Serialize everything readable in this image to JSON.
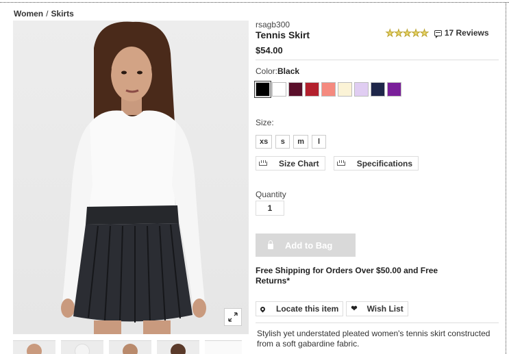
{
  "breadcrumb": {
    "parent": "Women",
    "separator": "/",
    "current": "Skirts"
  },
  "product": {
    "sku": "rsagb300",
    "title": "Tennis Skirt",
    "price": "$54.00",
    "rating": {
      "stars": 5,
      "max": 5,
      "reviews_label": "17 Reviews"
    },
    "color": {
      "label": "Color:",
      "selected": "Black",
      "swatches": [
        "#000000",
        "#ffffff",
        "#5a0f2a",
        "#b3202d",
        "#f58a7f",
        "#fbf3d6",
        "#e0cdf2",
        "#1e2649",
        "#7a1f9a"
      ]
    },
    "size": {
      "label": "Size:",
      "options": [
        "xs",
        "s",
        "m",
        "l"
      ]
    },
    "links": {
      "size_chart": "Size Chart",
      "specifications": "Specifications"
    },
    "quantity": {
      "label": "Quantity",
      "value": "1"
    },
    "add_to_bag": "Add to Bag",
    "shipping_note": "Free Shipping for Orders Over $50.00 and Free Returns*",
    "actions": {
      "locate": "Locate this item",
      "wishlist": "Wish List"
    },
    "description": "Stylish yet understated pleated women's tennis skirt constructed from a soft gabardine fabric."
  },
  "icons": {
    "expand": "expand-icon",
    "reviews": "comment-icon",
    "ruler": "ruler-icon",
    "lock": "lock-icon",
    "pin": "map-pin-icon",
    "heart": "heart-icon"
  }
}
